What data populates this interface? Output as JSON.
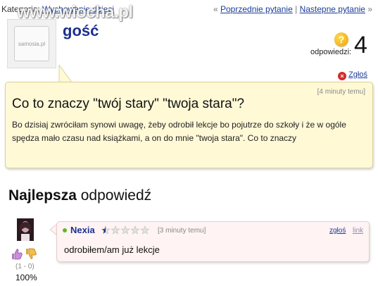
{
  "topbar": {
    "category_label": "Kategoria:",
    "category_link": "Wychowanie dzieci",
    "nav_prev_arrow": "«",
    "nav_prev": "Poprzednie pytanie",
    "nav_sep": "|",
    "nav_next": "Nastepne pytanie",
    "nav_next_arrow": "»"
  },
  "watermark": "www.wiocha.pl",
  "asker": {
    "avatar_text": "samosia.pl",
    "name": "gość"
  },
  "answers": {
    "icon": "question-icon",
    "icon_glyph": "?",
    "label": "odpowiedzi:",
    "count": "4"
  },
  "report": {
    "icon": "close-icon",
    "icon_glyph": "×",
    "label": "Zgłoś"
  },
  "question": {
    "time": "[4 minuty temu]",
    "title": "Co to znaczy \"twój stary\" \"twoja stara\"?",
    "body": "Bo dzisiaj zwróciłam synowi uwagę, żeby odrobił lekcje bo pojutrze do szkoły i że w ogóle spędza mało czasu nad książkami, a on do mnie \"twoja stara\". Co to znaczy",
    "background_color": "#fff9d6"
  },
  "best_answer": {
    "heading_bold": "Najlepsza",
    "heading_rest": " odpowiedź",
    "votes": {
      "up_icon": "thumbs-up-icon",
      "down_icon": "thumbs-down-icon",
      "counts": "(1 - 0)",
      "percent": "100%"
    },
    "answer": {
      "name": "Nexia",
      "stars_total": 5,
      "stars_filled": 0.5,
      "time": "[3 minuty temu]",
      "report": "zgłoś",
      "link": "link",
      "text": "odrobiłem/am już lekcje",
      "background_color": "#fff3f3"
    }
  },
  "colors": {
    "link": "#1a3d99",
    "username": "#1b2f8f",
    "online_dot": "#5cb82e"
  }
}
